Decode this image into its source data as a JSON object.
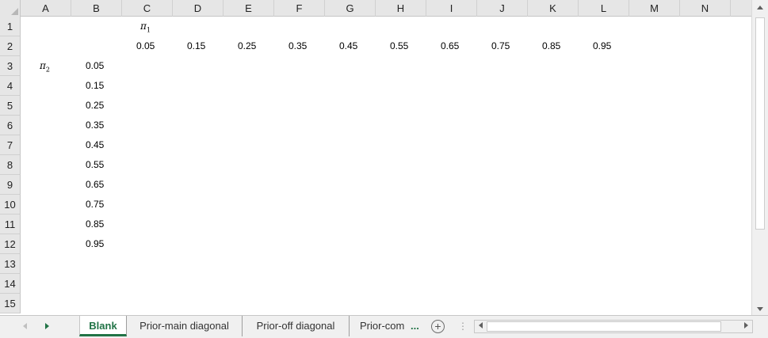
{
  "columns": [
    "A",
    "B",
    "C",
    "D",
    "E",
    "F",
    "G",
    "H",
    "I",
    "J",
    "K",
    "L",
    "M",
    "N"
  ],
  "rows": [
    "1",
    "2",
    "3",
    "4",
    "5",
    "6",
    "7",
    "8",
    "9",
    "10",
    "11",
    "12",
    "13",
    "14",
    "15"
  ],
  "pi1_symbol": "π",
  "pi1_sub": "1",
  "pi2_symbol": "π",
  "pi2_sub": "2",
  "header_values": [
    "0.05",
    "0.15",
    "0.25",
    "0.35",
    "0.45",
    "0.55",
    "0.65",
    "0.75",
    "0.85",
    "0.95"
  ],
  "row_values": [
    "0.05",
    "0.15",
    "0.25",
    "0.35",
    "0.45",
    "0.55",
    "0.65",
    "0.75",
    "0.85",
    "0.95"
  ],
  "tabs": [
    {
      "label": "Blank",
      "active": true
    },
    {
      "label": "Prior-main diagonal",
      "active": false
    },
    {
      "label": "Prior-off diagonal",
      "active": false
    },
    {
      "label": "Prior-com",
      "active": false
    }
  ],
  "tab_overflow": "...",
  "add_sheet_symbol": "+",
  "tab_separator": "⋮",
  "icons": {
    "tab_prev": "left-triangle",
    "tab_next": "right-triangle",
    "scroll_up": "up-triangle",
    "scroll_down": "down-triangle",
    "scroll_left": "left-triangle",
    "scroll_right": "right-triangle"
  },
  "colors": {
    "active_tab": "#217346",
    "header_bg": "#e6e6e6"
  }
}
